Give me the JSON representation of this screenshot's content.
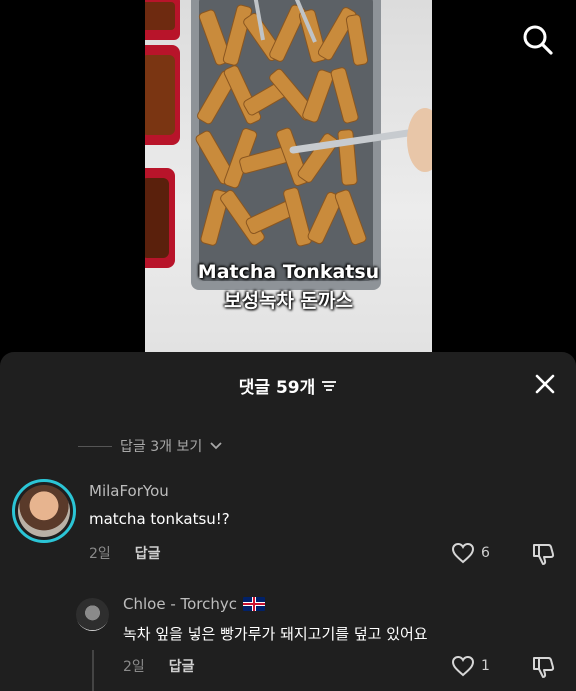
{
  "video": {
    "caption_line1": "Matcha Tonkatsu",
    "caption_line2": "보성녹차 돈까스"
  },
  "toolbar": {
    "search_icon": "search-icon"
  },
  "comments_panel": {
    "title": "댓글 59개",
    "sort_icon": "sort-icon",
    "close_icon": "close-icon",
    "view_replies_label": "답글 3개 보기",
    "comments": [
      {
        "username": "MilaForYou",
        "text": "matcha tonkatsu!?",
        "date": "2일",
        "reply_label": "답글",
        "likes": "6"
      }
    ],
    "replies": [
      {
        "username": "Chloe - Torchyc",
        "flag": "🇬🇧",
        "text": "녹차 잎을 넣은 빵가루가 돼지고기를 덮고 있어요",
        "date": "2일",
        "reply_label": "답글",
        "likes": "1"
      }
    ]
  },
  "colors": {
    "sheet_bg": "#1f1f1f",
    "avatar_ring": "#2bc5d6",
    "muted_text": "#8a8a8a"
  }
}
